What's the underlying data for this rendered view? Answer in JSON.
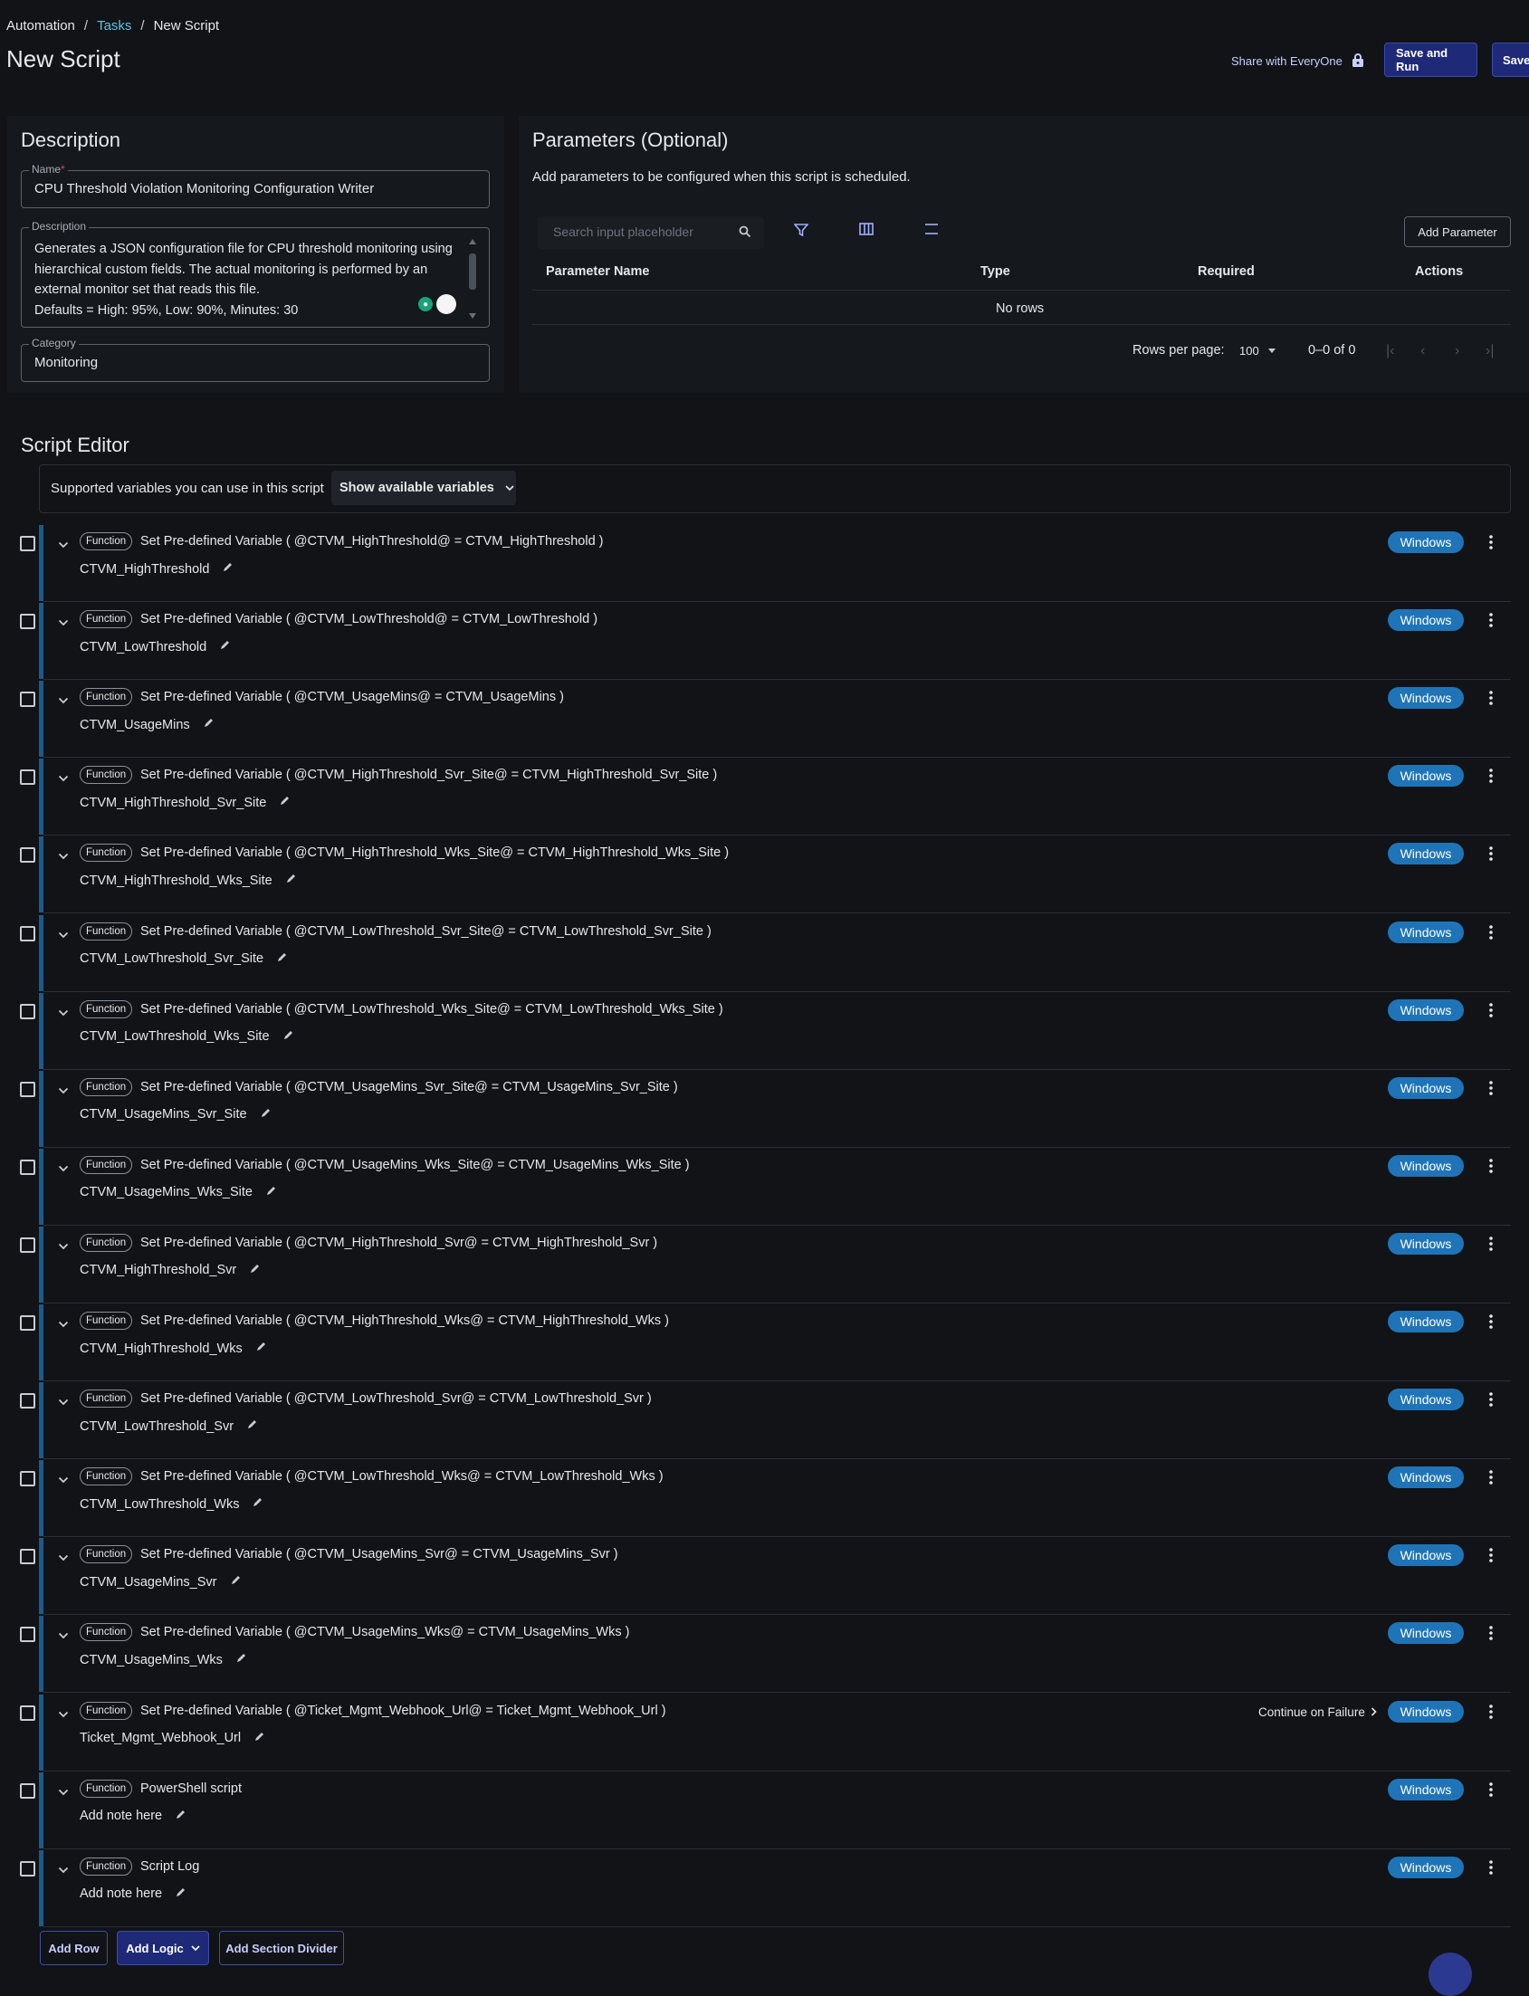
{
  "breadcrumb": {
    "root": "Automation",
    "sep1": "/",
    "tasks": "Tasks",
    "sep2": "/",
    "current": "New Script"
  },
  "page_title": "New Script",
  "header": {
    "share_label": "Share with EveryOne",
    "save_run_label": "Save and Run",
    "save_label": "Save"
  },
  "description_panel": {
    "title": "Description",
    "name_label": "Name",
    "name_required": "*",
    "name_value": "CPU Threshold Violation Monitoring Configuration Writer",
    "desc_label": "Description",
    "desc_value": "Generates a JSON configuration file for CPU threshold monitoring using hierarchical custom fields. The actual monitoring is performed by an external monitor set that reads this file.\nDefaults = High: 95%, Low: 90%, Minutes: 30",
    "category_label": "Category",
    "category_value": "Monitoring"
  },
  "params_panel": {
    "title": "Parameters (Optional)",
    "subtitle": "Add parameters to be configured when this script is scheduled.",
    "search_placeholder": "Search input placeholder",
    "add_button": "Add Parameter",
    "columns": [
      "Parameter Name",
      "Type",
      "Required",
      "Actions"
    ],
    "empty_text": "No rows",
    "rows_per_page_label": "Rows per page:",
    "rows_per_page_value": "100",
    "range_text": "0–0 of 0"
  },
  "editor": {
    "title": "Script Editor",
    "vars_label": "Supported variables you can use in this script",
    "vars_button": "Show available variables",
    "chip_label": "Function",
    "platform_label": "Windows",
    "continue_label": "Continue on Failure",
    "rows": [
      {
        "title": "Set Pre-defined Variable ( @CTVM_HighThreshold@ = CTVM_HighThreshold )",
        "note": "CTVM_HighThreshold"
      },
      {
        "title": "Set Pre-defined Variable ( @CTVM_LowThreshold@ = CTVM_LowThreshold )",
        "note": "CTVM_LowThreshold"
      },
      {
        "title": "Set Pre-defined Variable ( @CTVM_UsageMins@ = CTVM_UsageMins )",
        "note": "CTVM_UsageMins"
      },
      {
        "title": "Set Pre-defined Variable ( @CTVM_HighThreshold_Svr_Site@ = CTVM_HighThreshold_Svr_Site )",
        "note": "CTVM_HighThreshold_Svr_Site"
      },
      {
        "title": "Set Pre-defined Variable ( @CTVM_HighThreshold_Wks_Site@ = CTVM_HighThreshold_Wks_Site )",
        "note": "CTVM_HighThreshold_Wks_Site"
      },
      {
        "title": "Set Pre-defined Variable ( @CTVM_LowThreshold_Svr_Site@ = CTVM_LowThreshold_Svr_Site )",
        "note": "CTVM_LowThreshold_Svr_Site"
      },
      {
        "title": "Set Pre-defined Variable ( @CTVM_LowThreshold_Wks_Site@ = CTVM_LowThreshold_Wks_Site )",
        "note": "CTVM_LowThreshold_Wks_Site"
      },
      {
        "title": "Set Pre-defined Variable ( @CTVM_UsageMins_Svr_Site@ = CTVM_UsageMins_Svr_Site )",
        "note": "CTVM_UsageMins_Svr_Site"
      },
      {
        "title": "Set Pre-defined Variable ( @CTVM_UsageMins_Wks_Site@ = CTVM_UsageMins_Wks_Site )",
        "note": "CTVM_UsageMins_Wks_Site"
      },
      {
        "title": "Set Pre-defined Variable ( @CTVM_HighThreshold_Svr@ = CTVM_HighThreshold_Svr )",
        "note": "CTVM_HighThreshold_Svr"
      },
      {
        "title": "Set Pre-defined Variable ( @CTVM_HighThreshold_Wks@ = CTVM_HighThreshold_Wks )",
        "note": "CTVM_HighThreshold_Wks"
      },
      {
        "title": "Set Pre-defined Variable ( @CTVM_LowThreshold_Svr@ = CTVM_LowThreshold_Svr )",
        "note": "CTVM_LowThreshold_Svr"
      },
      {
        "title": "Set Pre-defined Variable ( @CTVM_LowThreshold_Wks@ = CTVM_LowThreshold_Wks )",
        "note": "CTVM_LowThreshold_Wks"
      },
      {
        "title": "Set Pre-defined Variable ( @CTVM_UsageMins_Svr@ = CTVM_UsageMins_Svr )",
        "note": "CTVM_UsageMins_Svr"
      },
      {
        "title": "Set Pre-defined Variable ( @CTVM_UsageMins_Wks@ = CTVM_UsageMins_Wks )",
        "note": "CTVM_UsageMins_Wks"
      },
      {
        "title": "Set Pre-defined Variable ( @Ticket_Mgmt_Webhook_Url@ = Ticket_Mgmt_Webhook_Url )",
        "note": "Ticket_Mgmt_Webhook_Url",
        "continue_on_failure": true
      },
      {
        "title": "PowerShell script",
        "note": "Add note here"
      },
      {
        "title": "Script Log",
        "note": "Add note here"
      }
    ],
    "add_row": "Add Row",
    "add_logic": "Add Logic",
    "add_divider": "Add Section Divider"
  },
  "colors": {
    "accent": "#1e2a78",
    "link": "#5ec4e8",
    "platform_badge": "#1f74b8",
    "row_bar": "#1c5a8a",
    "background": "#111316"
  }
}
